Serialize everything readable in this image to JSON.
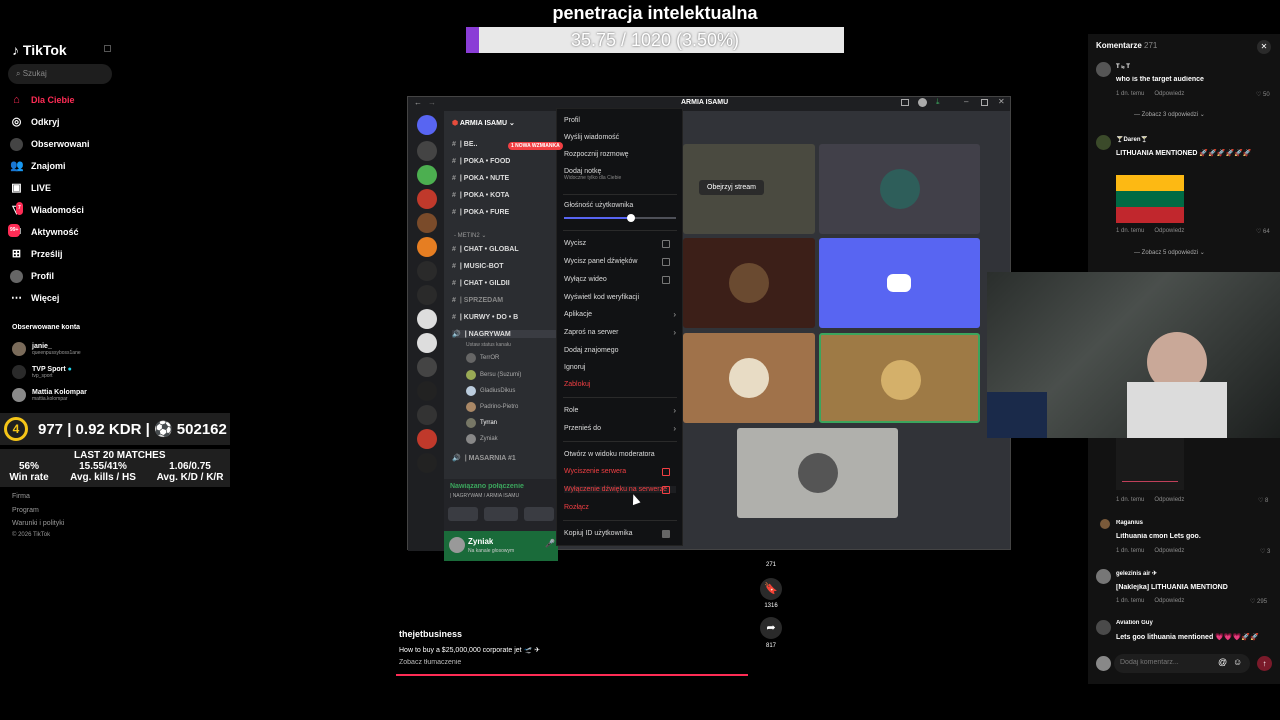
{
  "tiktok": {
    "logo": "TikTok",
    "search_placeholder": "Szukaj",
    "nav": [
      "Dla Ciebie",
      "Odkryj",
      "Obserwowani",
      "Znajomi",
      "LIVE",
      "Wiadomości",
      "Aktywność",
      "Prześlij",
      "Profil",
      "Więcej"
    ],
    "nav_badges": {
      "messages": "7",
      "activity": "99+"
    },
    "followed_header": "Obserwowane konta",
    "followed": [
      {
        "name": "janie_",
        "handle": "queenpussyboss1ane"
      },
      {
        "name": "TVP Sport",
        "handle": "tvp_sport"
      },
      {
        "name": "Mattia Kolompar",
        "handle": "mattia.kolompar"
      }
    ],
    "footer": [
      "Firma",
      "Program",
      "Warunki i polityki",
      "© 2026 TikTok"
    ],
    "video": {
      "author": "thejetbusiness",
      "caption": "How to buy a $25,000,000 corporate jet 🛫 ✈",
      "translate": "Zobacz tłumaczenie",
      "counts": [
        "271",
        "1316",
        "817"
      ]
    }
  },
  "stats": {
    "level": "4",
    "line1": "977 | 0.92 KDR | ⚽ 502162",
    "header": "LAST 20 MATCHES",
    "cols": [
      {
        "value": "56%",
        "label": "Win rate"
      },
      {
        "value": "15.55/41%",
        "label": "Avg. kills / HS"
      },
      {
        "value": "1.06/0.75",
        "label": "Avg. K/D / K/R"
      }
    ]
  },
  "banner": {
    "title": "penetracja intelektualna",
    "progress_text": "35.75 / 1020 (3.50%)",
    "progress": 0.035
  },
  "discord": {
    "title": "ARMIA ISAMU",
    "server_name": "ARMIA ISAMU",
    "new_badge": "1 NOWA WZMIANKA",
    "channels": [
      "| BE..",
      "| POKA • FOOD",
      "| POKA • NUTE",
      "| POKA • KOTA",
      "| POKA • FURE"
    ],
    "category": "METIN2",
    "channels2": [
      "| CHAT • GLOBAL",
      "| MUSIC-BOT",
      "| CHAT • GILDII",
      "| SPRZEDAM",
      "| KURWY • DO • B",
      "| NAGRYWAM"
    ],
    "voice_status": "Ustaw status kanału",
    "voice_users": [
      "TerrOR",
      "Bersu (Suzumi)",
      "GladiusDikus",
      "Padrino-Pietro",
      "Tyrran",
      "Zyniak"
    ],
    "channel_after": "| MASARNIA #1",
    "connected": "Nawiązano połączenie",
    "connected_sub": "| NAGRYWAM / ARMIA ISAMU",
    "me_name": "Zyniak",
    "me_status": "Na kanale głosowym",
    "watch_stream": "Obejrzyj stream",
    "menu": [
      {
        "label": "Profil"
      },
      {
        "label": "Wyślij wiadomość"
      },
      {
        "label": "Rozpocznij rozmowę"
      },
      {
        "label": "Dodaj notkę",
        "sub": "Widoczne tylko dla Ciebie"
      },
      {
        "label": "Głośność użytkownika"
      },
      {
        "label": "Wycisz"
      },
      {
        "label": "Wycisz panel dźwięków"
      },
      {
        "label": "Wyłącz wideo"
      },
      {
        "label": "Wyświetl kod weryfikacji"
      },
      {
        "label": "Aplikacje"
      },
      {
        "label": "Zaproś na serwer"
      },
      {
        "label": "Dodaj znajomego"
      },
      {
        "label": "Ignoruj"
      },
      {
        "label": "Zablokuj"
      },
      {
        "label": "Role"
      },
      {
        "label": "Przenieś do"
      },
      {
        "label": "Otwórz w widoku moderatora"
      },
      {
        "label": "Wyciszenie serwera"
      },
      {
        "label": "Wyłączenie dźwięku na serwerze"
      },
      {
        "label": "Rozłącz"
      },
      {
        "label": "Kopiuj ID użytkownika"
      }
    ],
    "volume": 0.6
  },
  "comments": {
    "header": "Komentarze",
    "count": "271",
    "items": [
      {
        "name": "T ₗₑ T",
        "text": "who is the target audience",
        "meta": "1 dn. temu",
        "reply": "Odpowiedz",
        "likes": "50",
        "more": "Zobacz 3 odpowiedzi"
      },
      {
        "name": "🍸Daren🍸",
        "text": "LITHUANIA MENTIONED 🚀🚀🚀🚀🚀🚀",
        "meta": "1 dn. temu",
        "reply": "Odpowiedz",
        "likes": "64",
        "more": "Zobacz 5 odpowiedzi"
      },
      {
        "name": "",
        "text": "",
        "meta": "1 dn. temu",
        "reply": "Odpowiedz",
        "likes": "8"
      },
      {
        "name": "Raganiūs",
        "text": "Lithuania cmon Lets goo.",
        "meta": "1 dn. temu",
        "reply": "Odpowiedz",
        "likes": "3"
      },
      {
        "name": "gelezinis air ✈",
        "text": "[Naklejka] LITHUANIA MENTIOND",
        "meta": "1 dn. temu",
        "reply": "Odpowiedz",
        "likes": "295"
      },
      {
        "name": "Aviation Guy",
        "text": "Lets goo lithuania mentioned 💗💗💗🚀🚀"
      }
    ],
    "input_placeholder": "Dodaj komentarz..."
  }
}
